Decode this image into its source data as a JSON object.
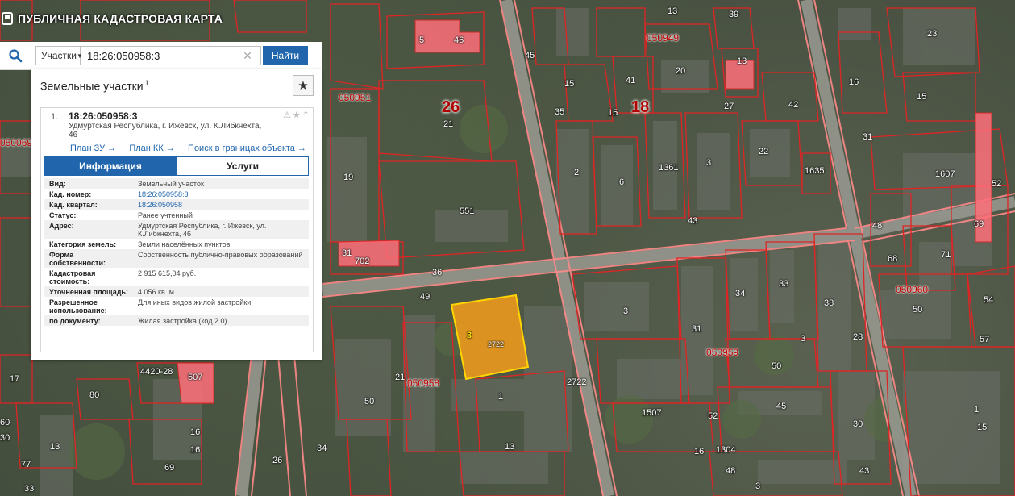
{
  "app": {
    "title": "ПУБЛИЧНАЯ КАДАСТРОВАЯ КАРТА"
  },
  "search": {
    "type_label": "Участки",
    "query": "18:26:050958:3",
    "button_label": "Найти"
  },
  "panel": {
    "title": "Земельные участки",
    "count_sup": "1",
    "result": {
      "index": "1.",
      "number": "18:26:050958:3",
      "address": "Удмуртская Республика, г. Ижевск, ул. К.Либкнехта, 46",
      "links": [
        "План ЗУ →",
        "План КК →",
        "Поиск в границах объекта →"
      ],
      "tabs": {
        "info": "Информация",
        "services": "Услуги"
      },
      "rows": [
        {
          "key": "Вид:",
          "value": "Земельный участок"
        },
        {
          "key": "Кад. номер:",
          "value": "18:26:050958:3"
        },
        {
          "key": "Кад. квартал:",
          "value": "18:26:050958"
        },
        {
          "key": "Статус:",
          "value": "Ранее учтенный"
        },
        {
          "key": "Адрес:",
          "value": "Удмуртская Республика, г. Ижевск, ул. К.Либкнехта, 46"
        },
        {
          "key": "Категория земель:",
          "value": "Земли населённых пунктов"
        },
        {
          "key": "Форма собственности:",
          "value": "Собственность публично-правовых образований"
        },
        {
          "key": "Кадастровая стоимость:",
          "value": "2 915 615,04 руб."
        },
        {
          "key": "Уточненная площадь:",
          "value": "4 056 кв. м"
        },
        {
          "key": "Разрешенное использование:",
          "value": "Для иных видов жилой застройки"
        },
        {
          "key": "по документу:",
          "value": "Жилая застройка (код 2.0)"
        }
      ]
    }
  },
  "map": {
    "quarters": [
      "050951",
      "050949",
      "050958",
      "050959",
      "050960",
      "050069",
      "050960"
    ],
    "big_numbers": [
      "26",
      "18"
    ],
    "plot_labels": [
      "5",
      "46",
      "39",
      "20",
      "13",
      "27",
      "42",
      "15",
      "16",
      "23",
      "15",
      "31",
      "41",
      "45",
      "35",
      "15",
      "13",
      "1361",
      "3",
      "22",
      "1635",
      "6",
      "2",
      "551",
      "21",
      "19",
      "43",
      "1607",
      "69",
      "48",
      "52",
      "71",
      "68",
      "36",
      "31",
      "702",
      "49",
      "3",
      "34",
      "33",
      "38",
      "50",
      "54",
      "3",
      "31",
      "28",
      "30",
      "2722",
      "1",
      "13",
      "50",
      "57",
      "45",
      "1",
      "1507",
      "52",
      "16",
      "1304",
      "48",
      "43",
      "3",
      "21",
      "16",
      "50",
      "69",
      "33",
      "26",
      "34",
      "80",
      "17",
      "4420-28",
      "507",
      "77",
      "13",
      "16",
      "15",
      "30",
      "60"
    ],
    "selected": {
      "label_a": "3",
      "label_b": "2722"
    }
  }
}
